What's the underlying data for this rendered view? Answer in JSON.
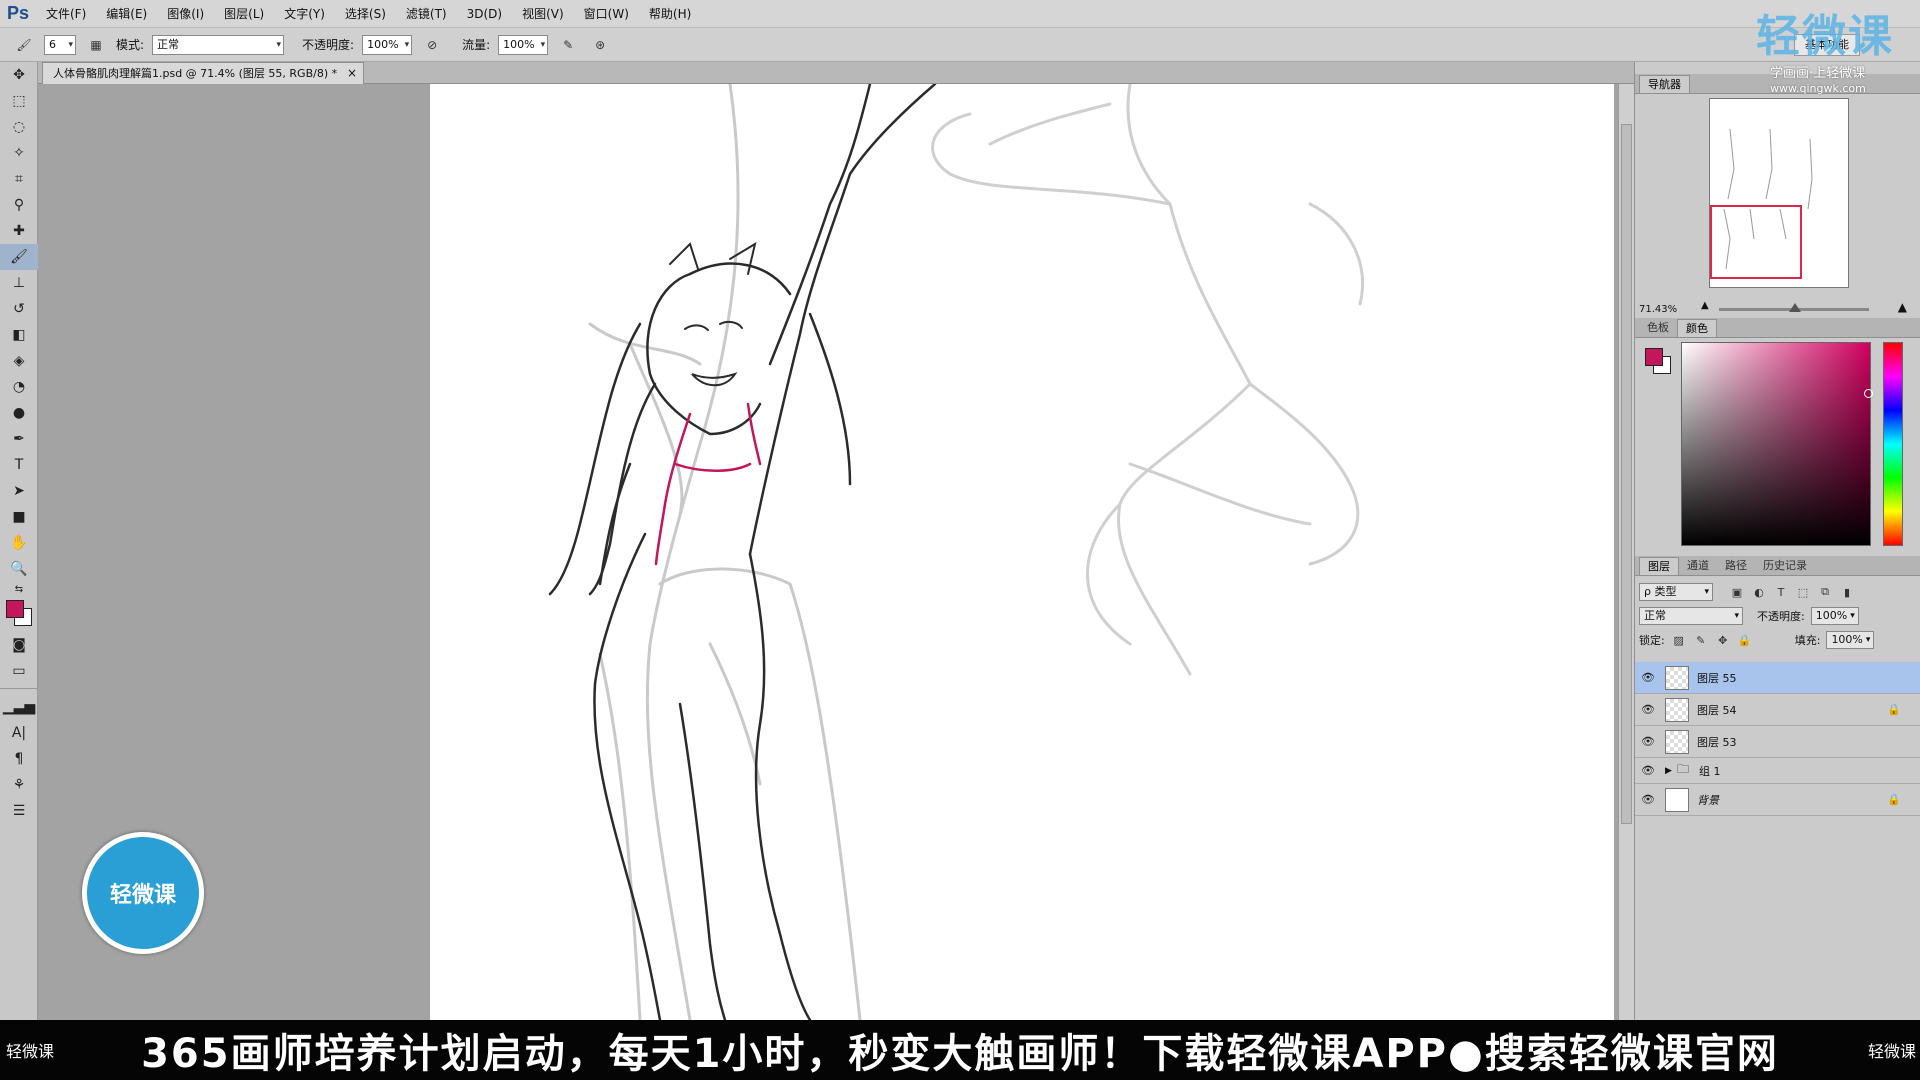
{
  "app": {
    "logo": "Ps"
  },
  "menu": [
    "文件(F)",
    "编辑(E)",
    "图像(I)",
    "图层(L)",
    "文字(Y)",
    "选择(S)",
    "滤镜(T)",
    "3D(D)",
    "视图(V)",
    "窗口(W)",
    "帮助(H)"
  ],
  "options": {
    "brush_size": "6",
    "mode_label": "模式:",
    "mode_value": "正常",
    "opacity_label": "不透明度:",
    "opacity_value": "100%",
    "flow_label": "流量:",
    "flow_value": "100%",
    "workspace": "基本功能"
  },
  "document": {
    "tab_title": "人体骨骼肌肉理解篇1.psd @ 71.4% (图层 55, RGB/8) *",
    "close": "×"
  },
  "navigator": {
    "tab": "导航器",
    "zoom": "71.43%"
  },
  "color_panel": {
    "tabs": [
      "色板",
      "颜色"
    ],
    "fg_color": "#c2185b",
    "bg_color": "#ffffff"
  },
  "layers_panel": {
    "tabs": [
      "图层",
      "通道",
      "路径",
      "历史记录"
    ],
    "filter_label": "ρ 类型",
    "blend_mode": "正常",
    "opacity_label": "不透明度:",
    "opacity_value": "100%",
    "lock_label": "锁定:",
    "fill_label": "填充:",
    "fill_value": "100%",
    "layers": [
      {
        "name": "图层 55",
        "selected": true,
        "locked": false
      },
      {
        "name": "图层 54",
        "selected": false,
        "locked": true
      },
      {
        "name": "图层 53",
        "selected": false,
        "locked": false
      }
    ],
    "group": {
      "name": "组 1"
    },
    "background": {
      "name": "背景",
      "locked": true
    }
  },
  "watermark": {
    "logo": "轻微课",
    "subtitle": "学画画·上轻微课",
    "url": "www.qingwk.com",
    "badge": "轻微课"
  },
  "banner": {
    "left_logo": "轻微课",
    "text": "365画师培养计划启动，每天1小时，秒变大触画师！下载轻微课APP●搜索轻微课官网",
    "right_logo": "轻微课"
  }
}
